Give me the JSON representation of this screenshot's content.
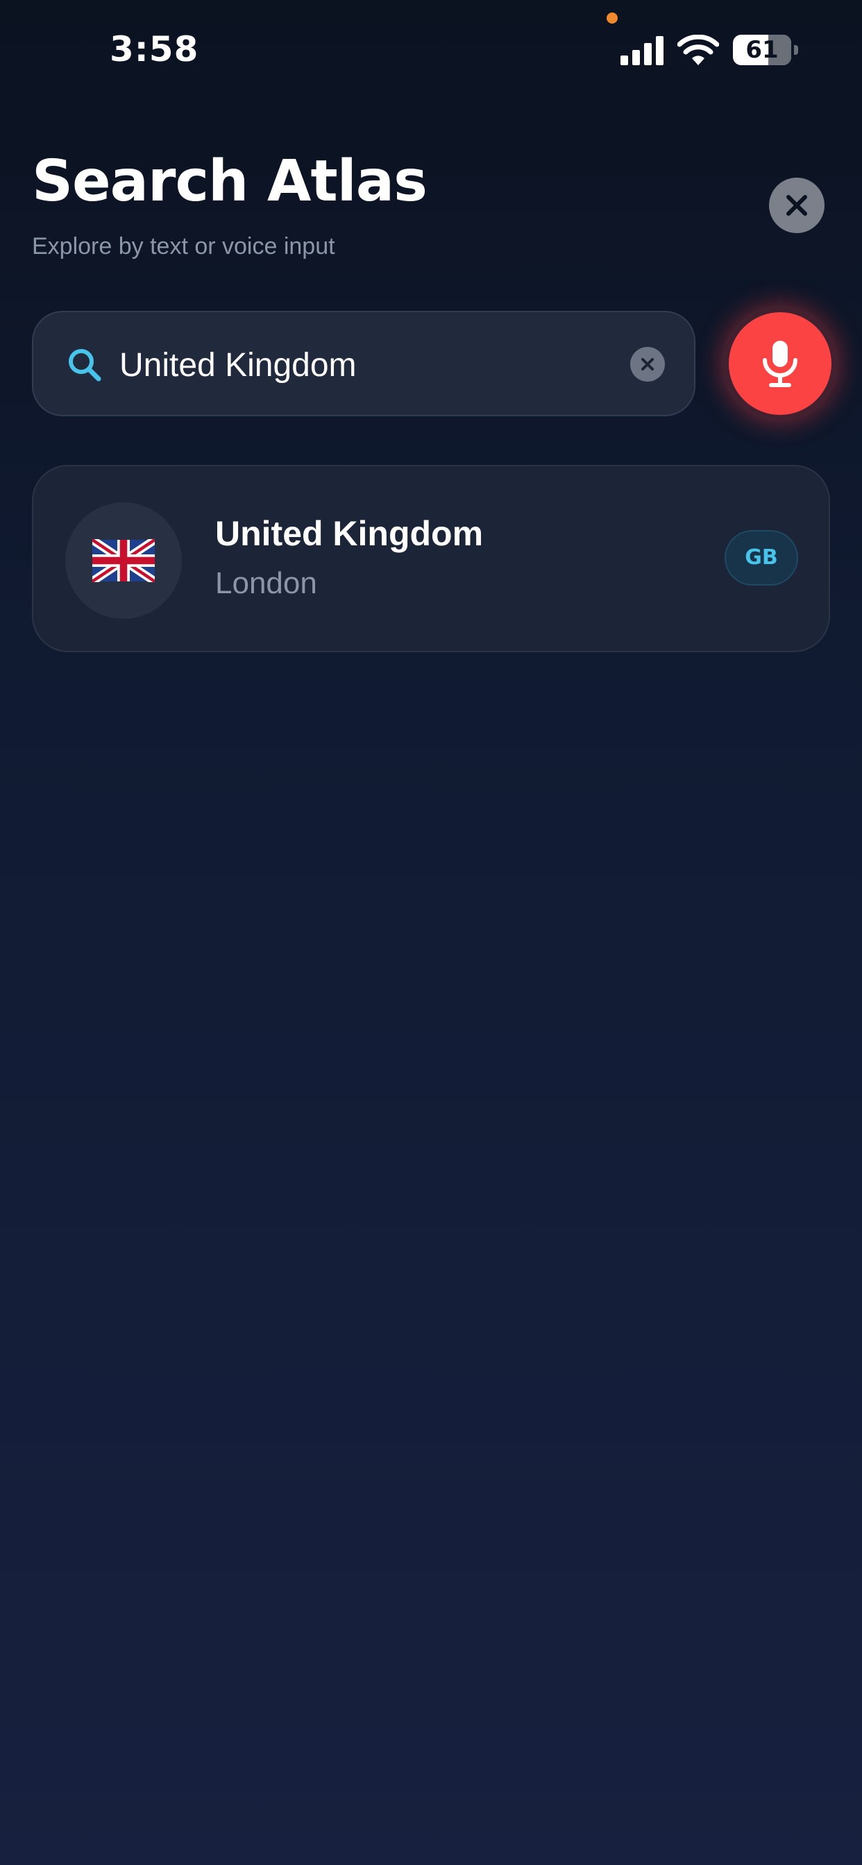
{
  "status_bar": {
    "time": "3:58",
    "battery_percent": "61",
    "battery_level": 0.61
  },
  "header": {
    "title": "Search Atlas",
    "subtitle": "Explore by text or voice input"
  },
  "search": {
    "value": "United Kingdom",
    "placeholder": ""
  },
  "results": [
    {
      "flag_icon": "uk-flag-icon",
      "country": "United Kingdom",
      "capital": "London",
      "code": "GB"
    }
  ],
  "colors": {
    "accent": "#48c3ea",
    "mic": "#fb4343",
    "background_top": "#0b1220",
    "background_bottom": "#17213f"
  },
  "icons": {
    "close": "close-icon",
    "search": "search-icon",
    "clear": "clear-icon",
    "mic": "microphone-icon"
  }
}
